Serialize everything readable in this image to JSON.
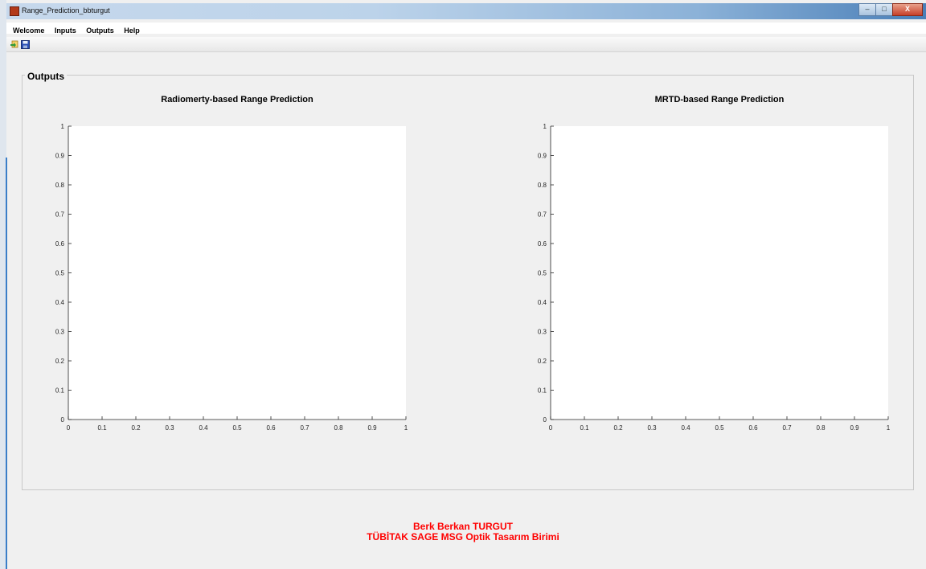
{
  "window": {
    "title": "Range_Prediction_bbturgut",
    "controls": {
      "minimize": "–",
      "maximize": "□",
      "close": "X"
    }
  },
  "menu": [
    "Welcome",
    "Inputs",
    "Outputs",
    "Help"
  ],
  "toolbar": {
    "icons": [
      "open-icon",
      "save-icon"
    ]
  },
  "panel": {
    "title": "Outputs"
  },
  "chart_data": [
    {
      "type": "line",
      "title": "Radiomerty-based Range Prediction",
      "xlabel": "",
      "ylabel": "",
      "xlim": [
        0,
        1
      ],
      "ylim": [
        0,
        1
      ],
      "xticks": [
        "0",
        "0.1",
        "0.2",
        "0.3",
        "0.4",
        "0.5",
        "0.6",
        "0.7",
        "0.8",
        "0.9",
        "1"
      ],
      "yticks": [
        "0",
        "0.1",
        "0.2",
        "0.3",
        "0.4",
        "0.5",
        "0.6",
        "0.7",
        "0.8",
        "0.9",
        "1"
      ],
      "series": [],
      "grid": false
    },
    {
      "type": "line",
      "title": "MRTD-based Range Prediction",
      "xlabel": "",
      "ylabel": "",
      "xlim": [
        0,
        1
      ],
      "ylim": [
        0,
        1
      ],
      "xticks": [
        "0",
        "0.1",
        "0.2",
        "0.3",
        "0.4",
        "0.5",
        "0.6",
        "0.7",
        "0.8",
        "0.9",
        "1"
      ],
      "yticks": [
        "0",
        "0.1",
        "0.2",
        "0.3",
        "0.4",
        "0.5",
        "0.6",
        "0.7",
        "0.8",
        "0.9",
        "1"
      ],
      "series": [],
      "grid": false
    }
  ],
  "footer": {
    "line1": "Berk Berkan TURGUT",
    "line2": "TÜBİTAK SAGE MSG Optik Tasarım Birimi",
    "color": "#ff0000"
  }
}
